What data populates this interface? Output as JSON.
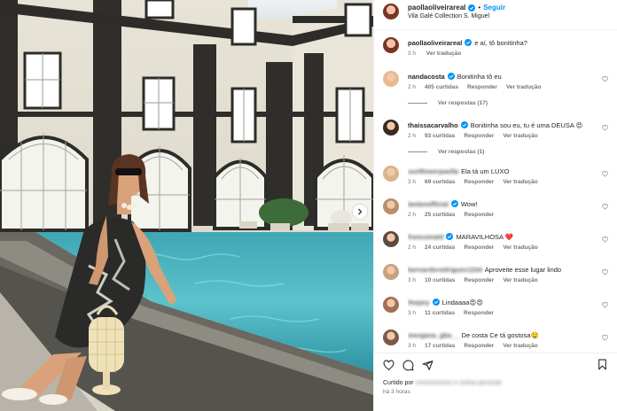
{
  "post": {
    "username": "paollaoliveirareal",
    "follow_label": "Seguir",
    "separator": "•",
    "location": "Vila Galé Collection S. Miguel"
  },
  "caption": {
    "username": "paollaoliveirareal",
    "text": "e aí, tô bonitinha?",
    "time": "3 h",
    "translate": "Ver tradução"
  },
  "comments": [
    {
      "username": "nandacosta",
      "verified": true,
      "text": "Bonitinha tô eu",
      "time": "2 h",
      "likes": "405 curtidas",
      "reply": "Responder",
      "translate": "Ver tradução",
      "blurred": false,
      "avatar_color": "#e9b98f",
      "replies_label": "Ver respostas (17)"
    },
    {
      "username": "thaissacarvalho",
      "verified": true,
      "text": "Bonitinha sou eu, tu é uma DEUSA 😍",
      "time": "2 h",
      "likes": "93 curtidas",
      "reply": "Responder",
      "translate": "Ver tradução",
      "blurred": false,
      "avatar_color": "#3a2a22",
      "replies_label": "Ver respostas (1)"
    },
    {
      "username": "sunflowerpaolla",
      "verified": false,
      "text": "Ela tá um LUXO",
      "time": "3 h",
      "likes": "69 curtidas",
      "reply": "Responder",
      "translate": "Ver tradução",
      "blurred": true,
      "avatar_color": "#d9b38c"
    },
    {
      "username": "lanlanofficial",
      "verified": true,
      "text": "Wow!",
      "time": "2 h",
      "likes": "25 curtidas",
      "reply": "Responder",
      "translate": "",
      "blurred": true,
      "avatar_color": "#b78f6a"
    },
    {
      "username": "francomald",
      "verified": true,
      "text": "MARAVILHOSA ❤️",
      "time": "2 h",
      "likes": "24 curtidas",
      "reply": "Responder",
      "translate": "Ver tradução",
      "blurred": true,
      "avatar_color": "#5f4a3c"
    },
    {
      "username": "bernardorodrigues1234",
      "verified": false,
      "text": "Aproveite esse lugar lindo",
      "time": "3 h",
      "likes": "10 curtidas",
      "reply": "Responder",
      "translate": "Ver tradução",
      "blurred": true,
      "avatar_color": "#c8a17f"
    },
    {
      "username": "thejary",
      "verified": true,
      "text": "Lindaaaa😍😍",
      "time": "3 h",
      "likes": "11 curtidas",
      "reply": "Responder",
      "translate": "",
      "blurred": true,
      "avatar_color": "#a26e55"
    },
    {
      "username": "morgana_gba__",
      "verified": false,
      "text": "De costa Ce tá gostosa🤤",
      "time": "3 h",
      "likes": "17 curtidas",
      "reply": "Responder",
      "translate": "Ver tradução",
      "blurred": true,
      "avatar_color": "#7c5a4a"
    }
  ],
  "footer": {
    "likes_prefix": "Curtido por",
    "likes_blurred": "xxxxxxxxxxxx e outras pessoas",
    "time_ago": "há 3 horas"
  },
  "colors": {
    "accent": "#0095f6",
    "verified": "#0095f6",
    "pool": "#4fb3bd"
  },
  "icons": [
    "verified-badge-icon",
    "more-options-icon",
    "heart-icon",
    "comment-icon",
    "share-icon",
    "bookmark-icon",
    "chevron-right-icon"
  ]
}
